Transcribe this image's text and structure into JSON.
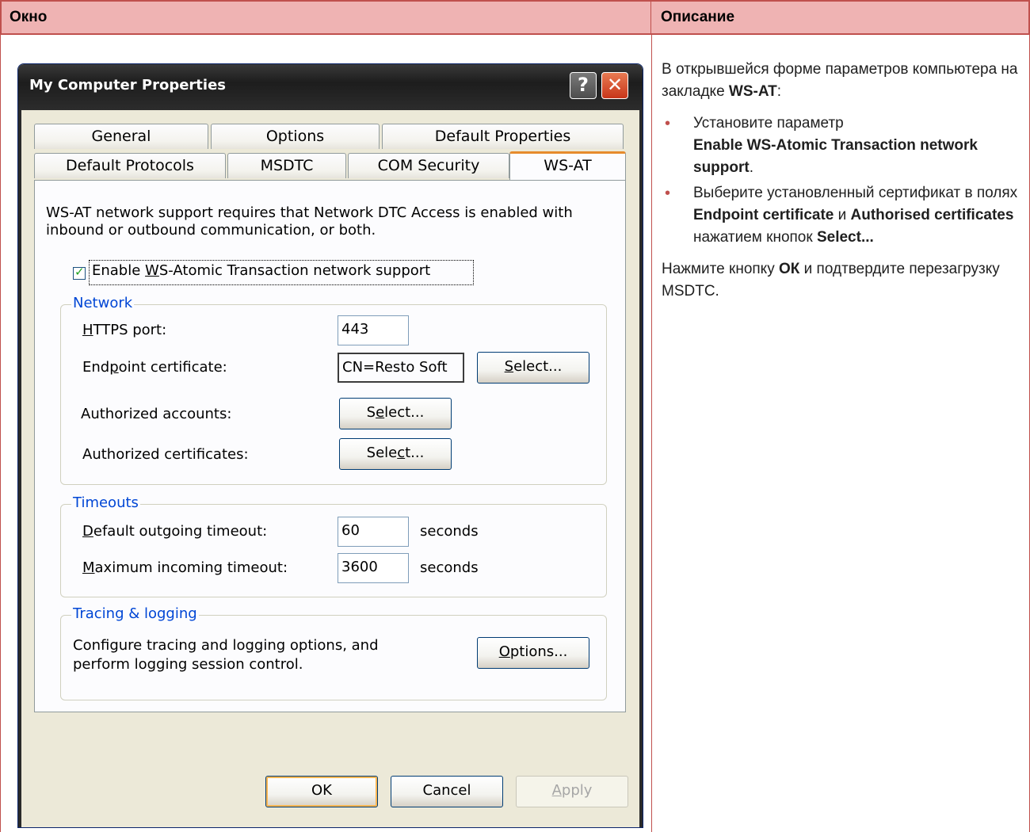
{
  "table": {
    "col_window": "Окно",
    "col_description": "Описание"
  },
  "description": {
    "p1_text": "В открывшейся форме параметров компьютера на закладке ",
    "p1_bold": "WS-AT",
    "p1_end": ":",
    "bullet1_text": "Установите параметр",
    "bullet1_bold": "Enable WS-Atomic Transaction network support",
    "bullet1_end": ".",
    "bullet2_text": "Выберите установленный сертификат в полях",
    "bullet2_bold1": "Endpoint certificate",
    "bullet2_and": " и ",
    "bullet2_bold2": "Authorised certificates",
    "bullet2_text2": "нажатием кнопок ",
    "bullet2_bold3": "Select...",
    "p2_text": "Нажмите кнопку ",
    "p2_bold": "ОК",
    "p2_end": " и подтвердите перезагрузку MSDTC."
  },
  "window": {
    "title": "My Computer Properties",
    "help_label": "?",
    "close_label": "✕",
    "tabs_row1": [
      "General",
      "Options",
      "Default Properties"
    ],
    "tabs_row2": [
      "Default Protocols",
      "MSDTC",
      "COM Security",
      "WS-AT"
    ],
    "active_tab": "WS-AT",
    "info_text_line1": "WS-AT network support requires that Network DTC Access is enabled with",
    "info_text_line2": "inbound or outbound communication, or both.",
    "enable_checkbox": {
      "label_pre": "Enable ",
      "label_ul": "W",
      "label_post": "S-Atomic Transaction network support",
      "checked": true
    },
    "network": {
      "title": "Network",
      "https_port_ul": "H",
      "https_port_rest": "TTPS port:",
      "https_port_value": "443",
      "endpoint_pre": "End",
      "endpoint_ul": "p",
      "endpoint_post": "oint certificate:",
      "endpoint_value": "CN=Resto Soft",
      "endpoint_select_ul": "S",
      "endpoint_select_rest": "elect...",
      "accounts_label": "Authorized accounts:",
      "accounts_select_pre": "S",
      "accounts_select_ul": "e",
      "accounts_select_post": "lect...",
      "certs_label": "Authorized certificates:",
      "certs_select_pre": "Sele",
      "certs_select_ul": "c",
      "certs_select_post": "t..."
    },
    "timeouts": {
      "title": "Timeouts",
      "outgoing_ul": "D",
      "outgoing_rest": "efault outgoing timeout:",
      "outgoing_value": "60",
      "incoming_ul": "M",
      "incoming_rest": "aximum incoming timeout:",
      "incoming_value": "3600",
      "unit": "seconds"
    },
    "tracing": {
      "title": "Tracing & logging",
      "text_line1": "Configure tracing and logging options, and",
      "text_line2": "perform logging session control.",
      "options_ul": "O",
      "options_rest": "ptions..."
    },
    "ok_label": "OK",
    "cancel_label": "Cancel",
    "apply_ul": "A",
    "apply_rest": "pply"
  }
}
